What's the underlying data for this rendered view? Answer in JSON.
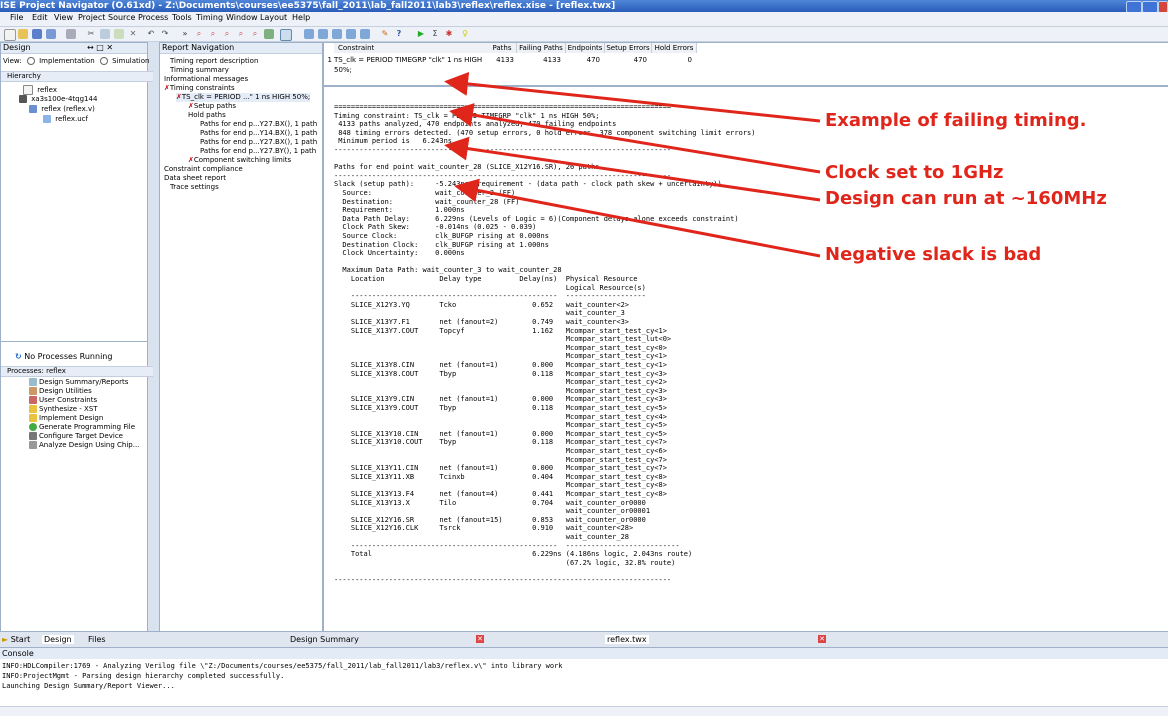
{
  "window": {
    "title": "ISE Project Navigator (O.61xd) - Z:\\Documents\\courses\\ee5375\\fall_2011\\lab_fall2011\\lab3\\reflex\\reflex.xise - [reflex.twx]"
  },
  "menu": [
    "File",
    "Edit",
    "View",
    "Project",
    "Source",
    "Process",
    "Tools",
    "Timing",
    "Window",
    "Layout",
    "Help"
  ],
  "design_panel": {
    "title": "Design",
    "view_label": "View:",
    "impl_label": "Implementation",
    "sim_label": "Simulation",
    "hierarchy_label": "Hierarchy",
    "tree": [
      "reflex",
      "xa3s100e-4tqg144",
      "reflex (reflex.v)",
      "reflex.ucf"
    ]
  },
  "processes_panel": {
    "status": "No Processes Running",
    "title": "Processes: reflex",
    "items": [
      "Design Summary/Reports",
      "Design Utilities",
      "User Constraints",
      "Synthesize - XST",
      "Implement Design",
      "Generate Programming File",
      "Configure Target Device",
      "Analyze Design Using Chip..."
    ]
  },
  "report_nav": {
    "title": "Report Navigation",
    "items": [
      "Timing report description",
      "Timing summary",
      "Informational messages",
      "Timing constraints",
      "TS_clk = PERIOD ...\" 1 ns HIGH 50%;",
      "Setup paths",
      "Hold paths",
      "Paths for end p...Y27.BX(), 1 path",
      "Paths for end p...Y14.BX(), 1 path",
      "Paths for end p...Y27.BX(), 1 path",
      "Paths for end p...Y27.BY(), 1 path",
      "Component switching limits",
      "Constraint compliance",
      "Data sheet report",
      "Trace settings"
    ]
  },
  "constraint_table": {
    "headers": [
      "Constraint",
      "Paths",
      "Failing Paths",
      "Endpoints",
      "Setup Errors",
      "Hold Errors"
    ],
    "row": [
      "1",
      "TS_clk = PERIOD TIMEGRP \"clk\" 1 ns HIGH 50%;",
      "4133",
      "4133",
      "470",
      "470",
      "0"
    ]
  },
  "report_text": [
    "================================================================================",
    "Timing constraint: TS_clk = PERIOD TIMEGRP \"clk\" 1 ns HIGH 50%;",
    " 4133 paths analyzed, 470 endpoints analyzed, 470 failing endpoints",
    " 848 timing errors detected. (470 setup errors, 0 hold errors, 378 component switching limit errors)",
    " Minimum period is   6.243ns.",
    "--------------------------------------------------------------------------------",
    "",
    "Paths for end point wait_counter_28 (SLICE_X12Y16.SR), 26 paths",
    "--------------------------------------------------------------------------------",
    "Slack (setup path):     -5.243ns (requirement - (data path - clock path skew + uncertainty))",
    "  Source:               wait_counter_3 (FF)",
    "  Destination:          wait_counter_28 (FF)",
    "  Requirement:          1.000ns",
    "  Data Path Delay:      6.229ns (Levels of Logic = 6)(Component delays alone exceeds constraint)",
    "  Clock Path Skew:      -0.014ns (0.025 - 0.039)",
    "  Source Clock:         clk_BUFGP rising at 0.000ns",
    "  Destination Clock:    clk_BUFGP rising at 1.000ns",
    "  Clock Uncertainty:    0.000ns",
    "",
    "  Maximum Data Path: wait_counter_3 to wait_counter_28",
    "    Location             Delay type         Delay(ns)  Physical Resource",
    "                                                       Logical Resource(s)",
    "    -------------------------------------------------  -------------------",
    "    SLICE_X12Y3.YQ       Tcko                  0.652   wait_counter<2>",
    "                                                       wait_counter_3",
    "    SLICE_X13Y7.F1       net (fanout=2)        0.749   wait_counter<3>",
    "    SLICE_X13Y7.COUT     Topcyf                1.162   Mcompar_start_test_cy<1>",
    "                                                       Mcompar_start_test_lut<0>",
    "                                                       Mcompar_start_test_cy<0>",
    "                                                       Mcompar_start_test_cy<1>",
    "    SLICE_X13Y8.CIN      net (fanout=1)        0.000   Mcompar_start_test_cy<1>",
    "    SLICE_X13Y8.COUT     Tbyp                  0.118   Mcompar_start_test_cy<3>",
    "                                                       Mcompar_start_test_cy<2>",
    "                                                       Mcompar_start_test_cy<3>",
    "    SLICE_X13Y9.CIN      net (fanout=1)        0.000   Mcompar_start_test_cy<3>",
    "    SLICE_X13Y9.COUT     Tbyp                  0.118   Mcompar_start_test_cy<5>",
    "                                                       Mcompar_start_test_cy<4>",
    "                                                       Mcompar_start_test_cy<5>",
    "    SLICE_X13Y10.CIN     net (fanout=1)        0.000   Mcompar_start_test_cy<5>",
    "    SLICE_X13Y10.COUT    Tbyp                  0.118   Mcompar_start_test_cy<7>",
    "                                                       Mcompar_start_test_cy<6>",
    "                                                       Mcompar_start_test_cy<7>",
    "    SLICE_X13Y11.CIN     net (fanout=1)        0.000   Mcompar_start_test_cy<7>",
    "    SLICE_X13Y11.XB      Tcinxb                0.404   Mcompar_start_test_cy<8>",
    "                                                       Mcompar_start_test_cy<8>",
    "    SLICE_X13Y13.F4      net (fanout=4)        0.441   Mcompar_start_test_cy<8>",
    "    SLICE_X13Y13.X       Tilo                  0.704   wait_counter_or0000",
    "                                                       wait_counter_or00001",
    "    SLICE_X12Y16.SR      net (fanout=15)       0.853   wait_counter_or0000",
    "    SLICE_X12Y16.CLK     Tsrck                 0.910   wait_counter<28>",
    "                                                       wait_counter_28",
    "    -------------------------------------------------  ---------------------------",
    "    Total                                      6.229ns (4.186ns logic, 2.043ns route)",
    "                                                       (67.2% logic, 32.8% route)",
    "",
    "--------------------------------------------------------------------------------"
  ],
  "annotations": {
    "a1": "Example of failing timing.",
    "a2": "Clock set to 1GHz",
    "a3": "Design can run at ~160MHz",
    "a4": "Negative slack is bad"
  },
  "tabs": {
    "start": "Start",
    "design": "Design",
    "files": "Files",
    "design_summary": "Design Summary",
    "twx": "reflex.twx"
  },
  "console": {
    "title": "Console",
    "lines": [
      "INFO:HDLCompiler:1769 - Analyzing Verilog file \\\"Z:/Documents/courses/ee5375/fall_2011/lab_fall2011/lab3/reflex.v\\\" into library work",
      "INFO:ProjectMgmt - Parsing design hierarchy completed successfully.",
      "Launching Design Summary/Report Viewer..."
    ]
  },
  "colors": {
    "annotation": "#e0251b",
    "link": "#1a1ab6",
    "title": "#2a5cb8"
  }
}
